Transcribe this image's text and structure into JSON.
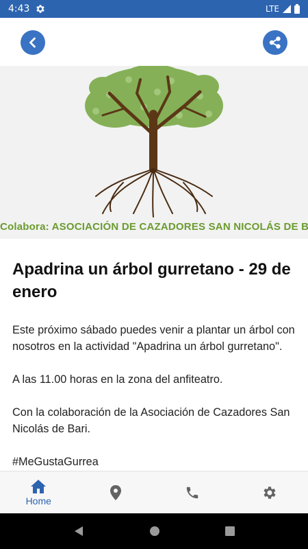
{
  "status_bar": {
    "time": "4:43",
    "network": "LTE"
  },
  "topbar": {
    "back_icon": "chevron-left-icon",
    "share_icon": "share-icon"
  },
  "banner": {
    "caption": "Colabora: ASOCIACIÓN DE CAZADORES SAN NICOLÁS DE BARI"
  },
  "article": {
    "title": "Apadrina un árbol gurretano - 29 de enero",
    "paragraphs": [
      "Este próximo sábado puedes venir a plantar un árbol con nosotros en la actividad \"Apadrina un árbol gurretano\".",
      "A las 11.00 horas en la zona del anfiteatro.",
      "Con la colaboración de la Asociación de Cazadores San Nicolás de Bari.",
      "#MeGustaGurrea"
    ]
  },
  "bottom_nav": {
    "home_label": "Home",
    "items": [
      "home-icon",
      "map-pin-icon",
      "phone-icon",
      "settings-icon"
    ]
  },
  "colors": {
    "accent": "#2d64b0",
    "button": "#3a73c4",
    "caption_green": "#6b9b2f"
  }
}
